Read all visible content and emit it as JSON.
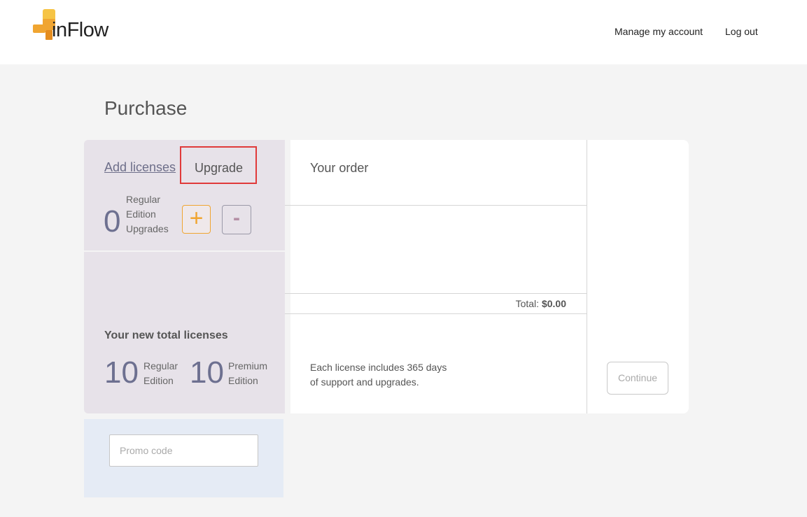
{
  "header": {
    "logo_text": "inFlow",
    "nav": {
      "manage_account": "Manage my account",
      "logout": "Log out"
    }
  },
  "page": {
    "title": "Purchase"
  },
  "tabs": {
    "add_licenses": "Add licenses",
    "upgrade": "Upgrade"
  },
  "upgrade_selector": {
    "count": "0",
    "label_line1": "Regular",
    "label_line2": "Edition",
    "label_line3": "Upgrades",
    "plus_symbol": "+",
    "minus_symbol": "-"
  },
  "new_totals": {
    "heading": "Your new total licenses",
    "regular": {
      "count": "10",
      "line1": "Regular",
      "line2": "Edition"
    },
    "premium": {
      "count": "10",
      "line1": "Premium",
      "line2": "Edition"
    }
  },
  "promo": {
    "placeholder": "Promo code",
    "value": ""
  },
  "order": {
    "title": "Your order",
    "total_label": "Total:",
    "total_value": "$0.00",
    "note_line1": "Each license includes 365 days",
    "note_line2": "of support and upgrades."
  },
  "actions": {
    "continue_label": "Continue"
  },
  "colors": {
    "accent": "#f0a531",
    "panel": "#e7e2e9",
    "promo_panel": "#e5ebf5",
    "highlight": "#e03a3a"
  },
  "icons": {
    "logo": "inflow-logo-icon"
  }
}
